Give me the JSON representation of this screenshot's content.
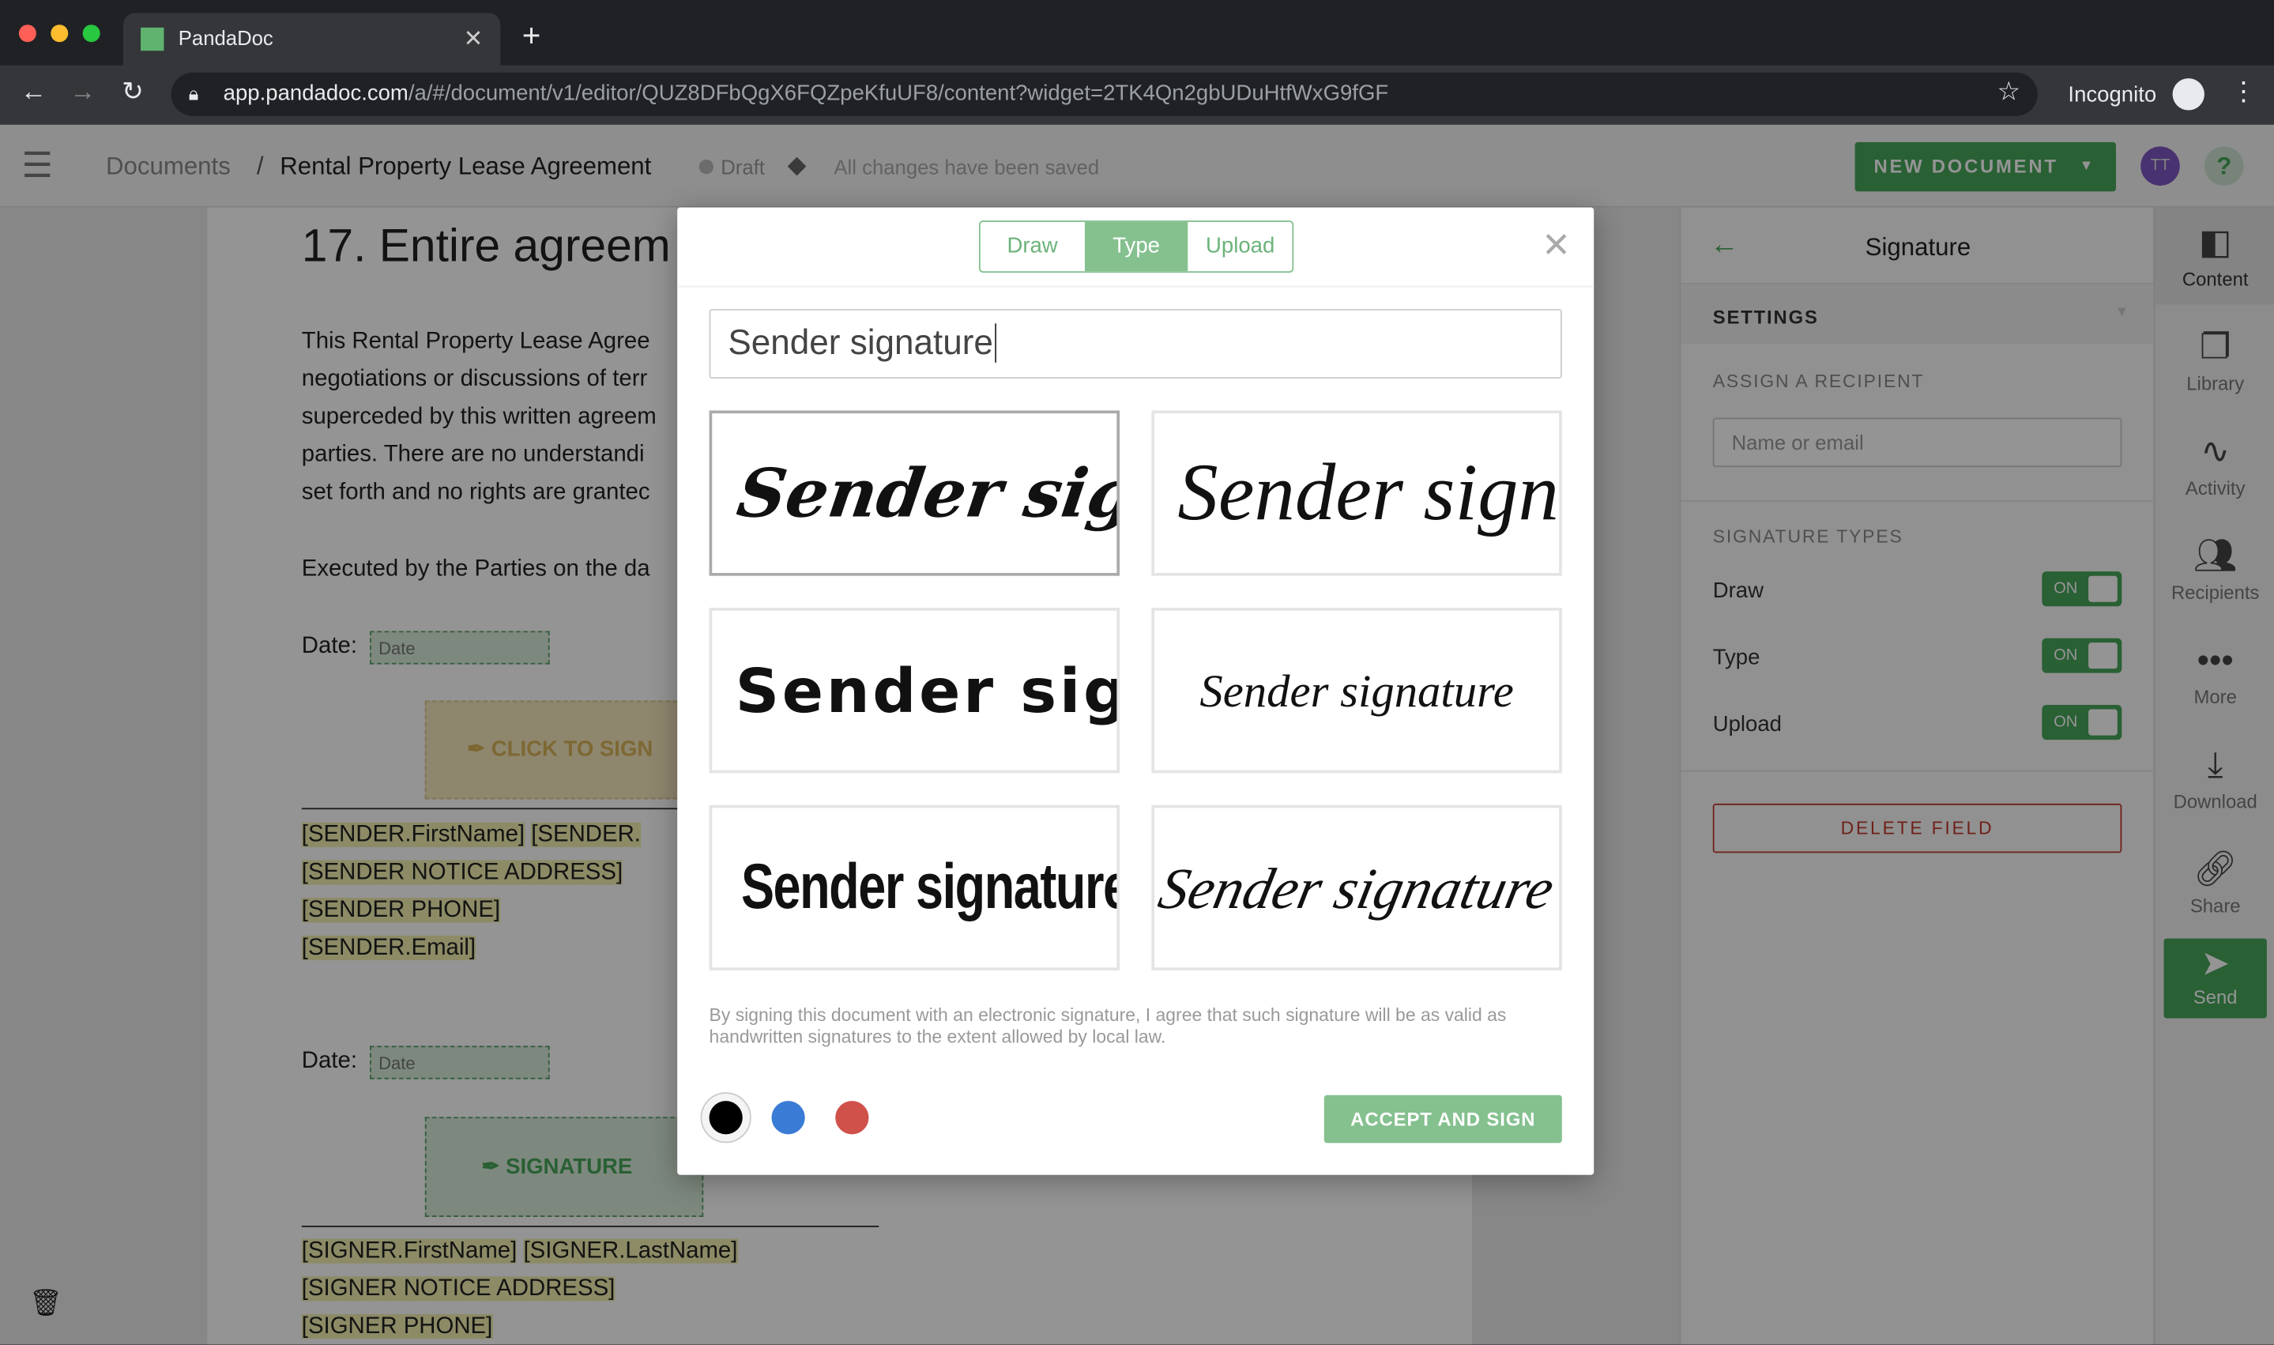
{
  "browser": {
    "tab_title": "PandaDoc",
    "favicon_text": "pd",
    "url_host": "app.pandadoc.com",
    "url_path": "/a/#/document/v1/editor/QUZ8DFbQgX6FQZpeKfuUF8/content?widget=2TK4Qn2gbUDuHtfWxG9fGF",
    "profile": "Incognito"
  },
  "header": {
    "breadcrumb_root": "Documents",
    "separator": "/",
    "doc_title": "Rental Property Lease Agreement",
    "status": "Draft",
    "save_status": "All changes have been saved",
    "new_document": "NEW DOCUMENT",
    "avatar": "TT",
    "help": "?"
  },
  "document": {
    "heading": "17. Entire agreem",
    "paragraph": [
      "This Rental Property Lease Agree",
      "negotiations or discussions of terr",
      "superceded by this written agreem",
      "parties. There are no understandi",
      "set forth and no rights are grantec"
    ],
    "executed": "Executed by the Parties on the da",
    "date_label": "Date:",
    "date_placeholder": "Date",
    "click_to_sign": "CLICK TO SIGN",
    "sender_lines": [
      "[SENDER.FirstName]",
      "[SENDER.",
      "[SENDER NOTICE ADDRESS]",
      "[SENDER PHONE]",
      "[SENDER.Email]"
    ],
    "signature_field": "SIGNATURE",
    "signer_lines": [
      "[SIGNER.FirstName]",
      "[SIGNER.LastName]",
      "[SIGNER NOTICE ADDRESS]",
      "[SIGNER PHONE]"
    ]
  },
  "panel": {
    "title": "Signature",
    "settings": "SETTINGS",
    "assign_label": "ASSIGN A RECIPIENT",
    "recipient_placeholder": "Name or email",
    "types_label": "SIGNATURE TYPES",
    "types": [
      {
        "label": "Draw",
        "state": "ON"
      },
      {
        "label": "Type",
        "state": "ON"
      },
      {
        "label": "Upload",
        "state": "ON"
      }
    ],
    "delete": "DELETE FIELD"
  },
  "sidebar": [
    {
      "label": "Content",
      "icon": "content-icon"
    },
    {
      "label": "Library",
      "icon": "library-icon"
    },
    {
      "label": "Activity",
      "icon": "activity-icon"
    },
    {
      "label": "Recipients",
      "icon": "recipients-icon"
    },
    {
      "label": "More",
      "icon": "more-icon"
    },
    {
      "label": "Download",
      "icon": "download-icon"
    },
    {
      "label": "Share",
      "icon": "share-icon"
    },
    {
      "label": "Send",
      "icon": "send-icon"
    }
  ],
  "modal": {
    "tabs": [
      "Draw",
      "Type",
      "Upload"
    ],
    "active_tab": "Type",
    "input_value": "Sender signature",
    "signature_options": [
      "Sender signat",
      "Sender sign",
      "Sender sign",
      "Sender signature",
      "Sender signature",
      "Sender signature"
    ],
    "selected_option": 0,
    "disclaimer": "By signing this document with an electronic signature, I agree that such signature will be as valid as handwritten signatures to the extent allowed by local law.",
    "colors": [
      "#000000",
      "#3a7bd5",
      "#d0504a"
    ],
    "selected_color": "#000000",
    "accept": "ACCEPT AND SIGN"
  },
  "colors": {
    "accent": "#47a55a",
    "modal_green": "#85c08f",
    "danger": "#c0392b"
  }
}
